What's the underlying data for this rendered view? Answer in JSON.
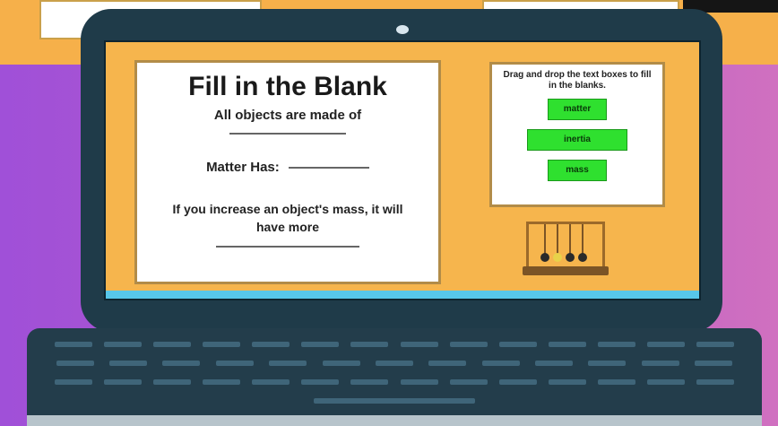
{
  "worksheet": {
    "title": "Fill in the Blank",
    "line1": "All objects are made of",
    "line2_label": "Matter Has:",
    "line3": "If you increase an object's mass, it will have more"
  },
  "drag_panel": {
    "instruction": "Drag and drop the text boxes to fill in the blanks.",
    "chips": [
      "matter",
      "inertia",
      "mass"
    ]
  },
  "colors": {
    "screen_background": "#f6b54d",
    "chip": "#2fe02f",
    "laptop_body": "#1f3b49",
    "page_gradient_start": "#a050d8",
    "page_gradient_end": "#d070c0"
  },
  "icons": {
    "illustration": "newtons-cradle-icon",
    "camera": "webcam-icon"
  }
}
